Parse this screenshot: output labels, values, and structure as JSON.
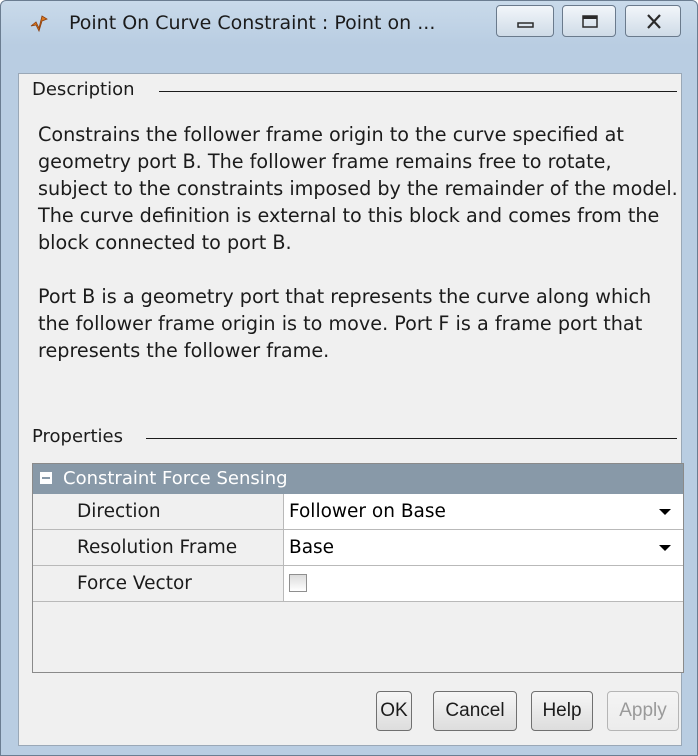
{
  "window": {
    "title": "Point On Curve Constraint : Point on ...",
    "icon": "matlab-block-icon",
    "controls": [
      "minimize-icon",
      "maximize-icon",
      "close-icon"
    ]
  },
  "description": {
    "group_label": "Description",
    "paragraphs": [
      "Constrains the follower frame origin to the curve specified at geometry port B. The follower frame remains free to rotate, subject to the constraints imposed by the remainder of the model. The curve definition is external to this block and comes from the block connected to port B.",
      "Port B is a geometry port that represents the curve along which the follower frame origin is to move. Port F is a frame port that represents the follower frame."
    ]
  },
  "properties": {
    "group_label": "Properties",
    "category": "Constraint Force Sensing",
    "rows": [
      {
        "name": "Direction",
        "value": "Follower on Base",
        "type": "dropdown"
      },
      {
        "name": "Resolution Frame",
        "value": "Base",
        "type": "dropdown"
      },
      {
        "name": "Force Vector",
        "value": "",
        "type": "checkbox",
        "checked": false
      }
    ]
  },
  "buttons": {
    "ok": "OK",
    "cancel": "Cancel",
    "help": "Help",
    "apply": "Apply"
  },
  "colors": {
    "title_bar": "#b9cde2",
    "category_header": "#8899a8",
    "client_bg": "#f0f0f0"
  }
}
